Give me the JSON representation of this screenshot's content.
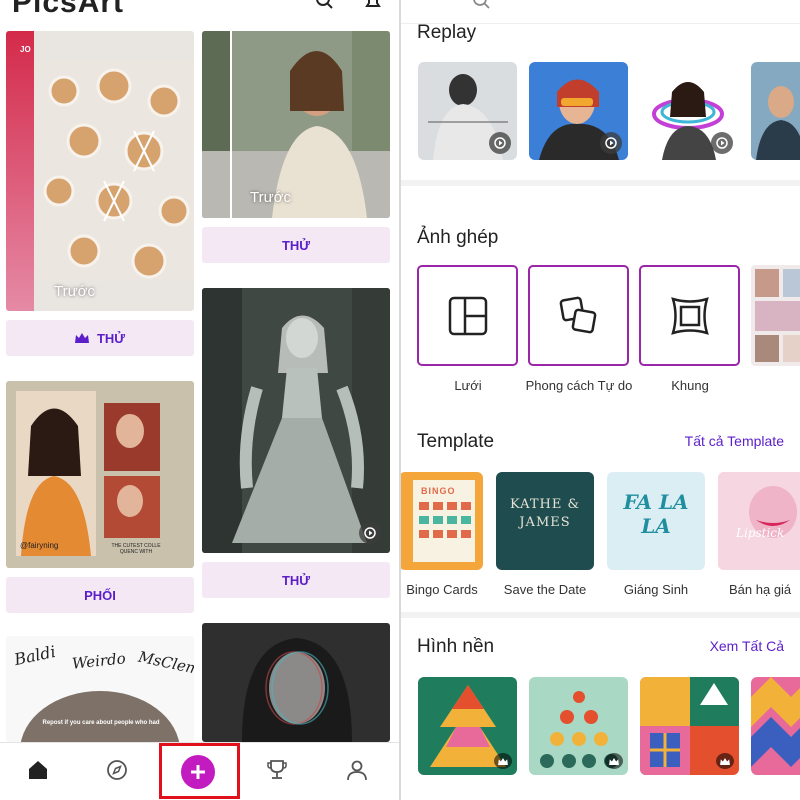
{
  "left_panel": {
    "brand": "PicsArt",
    "feed": {
      "card1": {
        "before_label": "Trước",
        "top_text": "JO"
      },
      "card1_action": "THỬ",
      "card2": {
        "before_label": "Trước"
      },
      "card2_action": "THỬ",
      "card3": {
        "handle": "@fairyning",
        "caption": "THE CUTEST COLLE QUENC WITH"
      },
      "card3_action": "PHỐI",
      "card4_action": "THỬ",
      "card5": {
        "words": [
          "Baldi",
          "Weirdo",
          "MsClem"
        ],
        "caption": "Repost if you care about people who had"
      }
    },
    "nav": {
      "home": "home-icon",
      "explore": "compass-icon",
      "create": "plus-icon",
      "challenges": "trophy-icon",
      "profile": "profile-icon"
    }
  },
  "right_panel": {
    "replay": {
      "title": "Replay"
    },
    "collage": {
      "title": "Ảnh ghép",
      "items": [
        {
          "label": "Lưới",
          "icon": "grid-icon"
        },
        {
          "label": "Phong cách Tự do",
          "icon": "freestyle-icon"
        },
        {
          "label": "Khung",
          "icon": "frame-icon"
        }
      ]
    },
    "template": {
      "title": "Template",
      "see_all": "Tất cả Template",
      "items": [
        {
          "label": "Bingo Cards",
          "art": "BINGO"
        },
        {
          "label": "Save the Date",
          "art": "KATHE & JAMES"
        },
        {
          "label": "Giáng Sinh",
          "art": "FA LA LA"
        },
        {
          "label": "Bán hạ giá",
          "art": "Lipstick"
        }
      ]
    },
    "wallpaper": {
      "title": "Hình nền",
      "see_all": "Xem Tất Cả"
    }
  },
  "colors": {
    "accent": "#5b1ec9",
    "create_button": "#c21bc0",
    "highlight": "#e0101c",
    "collage_border": "#9a26a8",
    "cta_bg": "#f3e8f4"
  }
}
